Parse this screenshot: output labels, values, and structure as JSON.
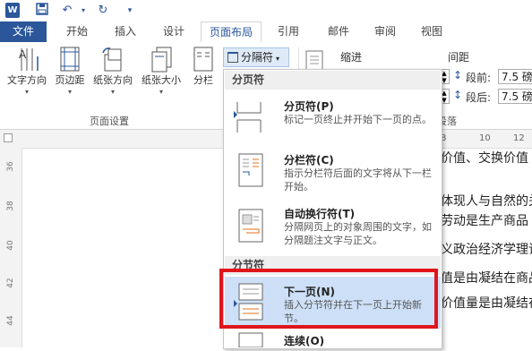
{
  "tabs": [
    "文件",
    "开始",
    "插入",
    "设计",
    "页面布局",
    "引用",
    "邮件",
    "审阅",
    "视图"
  ],
  "ribbon": {
    "buttons": [
      "文字方向",
      "页边距",
      "纸张方向",
      "纸张大小",
      "分栏"
    ],
    "group_label": "页面设置",
    "split_button": "分隔符",
    "indent_label": "缩进",
    "spacing_label": "间距",
    "before_label": "段前:",
    "before_value": "7.5 磅",
    "after_label": "段后:",
    "after_value": "7.5 磅",
    "paragraph_label": "段落"
  },
  "ruler": {
    "h_numbers": [
      "8",
      "10",
      "12"
    ],
    "v_numbers": [
      "36",
      "38",
      "40",
      "42",
      "44"
    ]
  },
  "document_lines": [
    "定价值、交换价值",
    "动体现人与自然的关",
    "象劳动是生产商品",
    "主义政治经济学理论",
    "价值是由凝结在商品",
    "品价值量是由凝结在"
  ],
  "menu": {
    "section1": "分页符",
    "section2": "分节符",
    "items": [
      {
        "title": "分页符(P)",
        "desc": "标记一页终止并开始下一页的点。"
      },
      {
        "title": "分栏符(C)",
        "desc": "指示分栏符后面的文字将从下一栏开始。"
      },
      {
        "title": "自动换行符(T)",
        "desc": "分隔网页上的对象周围的文字，如分隔题注文字与正文。"
      },
      {
        "title": "下一页(N)",
        "desc": "插入分节符并在下一页上开始新节。"
      },
      {
        "title": "连续(O)",
        "desc": ""
      }
    ]
  },
  "colors": {
    "accent": "#2b579a",
    "highlight": "#e0151c",
    "selected": "#cde0f7"
  }
}
